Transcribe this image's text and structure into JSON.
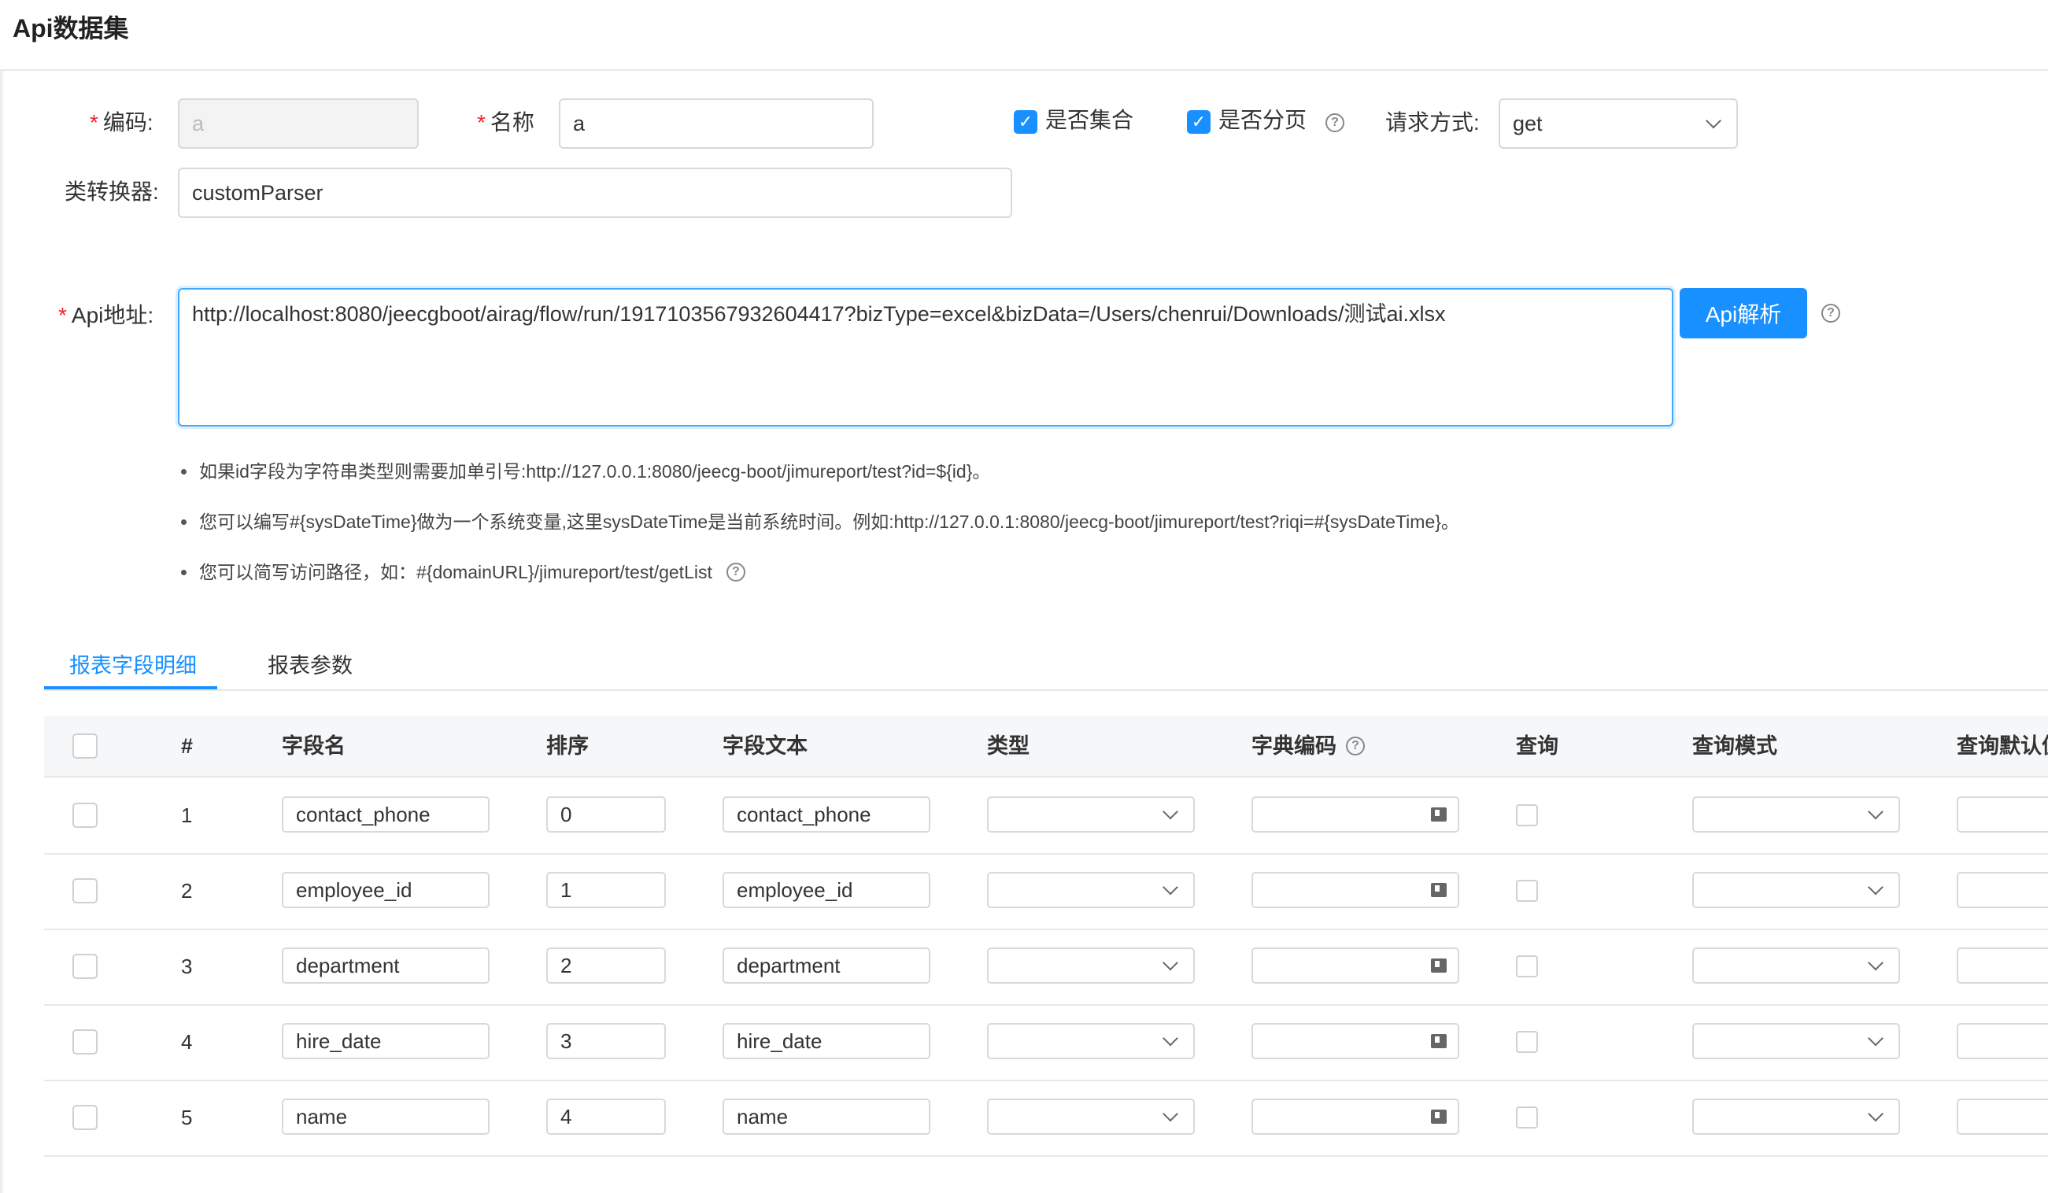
{
  "page": {
    "title": "Api数据集"
  },
  "form": {
    "code_label": "编码:",
    "code_value": "a",
    "name_label": "名称",
    "name_value": "a",
    "is_collection_label": "是否集合",
    "is_paged_label": "是否分页",
    "request_method_label": "请求方式:",
    "request_method_value": "get",
    "converter_label": "类转换器:",
    "converter_value": "customParser",
    "api_url_label": "Api地址:",
    "api_url_value": "http://localhost:8080/jeecgboot/airag/flow/run/1917103567932604417?bizType=excel&bizData=/Users/chenrui/Downloads/测试ai.xlsx",
    "parse_button": "Api解析",
    "required_mark": "*",
    "checked_mark": "✓",
    "help_mark": "?"
  },
  "tips": [
    "如果id字段为字符串类型则需要加单引号:http://127.0.0.1:8080/jeecg-boot/jimureport/test?id=${id}。",
    "您可以编写#{sysDateTime}做为一个系统变量,这里sysDateTime是当前系统时间。例如:http://127.0.0.1:8080/jeecg-boot/jimureport/test?riqi=#{sysDateTime}。",
    "您可以简写访问路径，如：#{domainURL}/jimureport/test/getList"
  ],
  "tabs": [
    "报表字段明细",
    "报表参数"
  ],
  "table": {
    "headers": [
      "#",
      "字段名",
      "排序",
      "字段文本",
      "类型",
      "字典编码",
      "查询",
      "查询模式",
      "查询默认值"
    ],
    "rows": [
      {
        "num": "1",
        "field": "contact_phone",
        "order": "0",
        "text": "contact_phone"
      },
      {
        "num": "2",
        "field": "employee_id",
        "order": "1",
        "text": "employee_id"
      },
      {
        "num": "3",
        "field": "department",
        "order": "2",
        "text": "department"
      },
      {
        "num": "4",
        "field": "hire_date",
        "order": "3",
        "text": "hire_date"
      },
      {
        "num": "5",
        "field": "name",
        "order": "4",
        "text": "name"
      }
    ]
  },
  "colors": {
    "primary": "#1890ff",
    "required": "#f5222d"
  }
}
